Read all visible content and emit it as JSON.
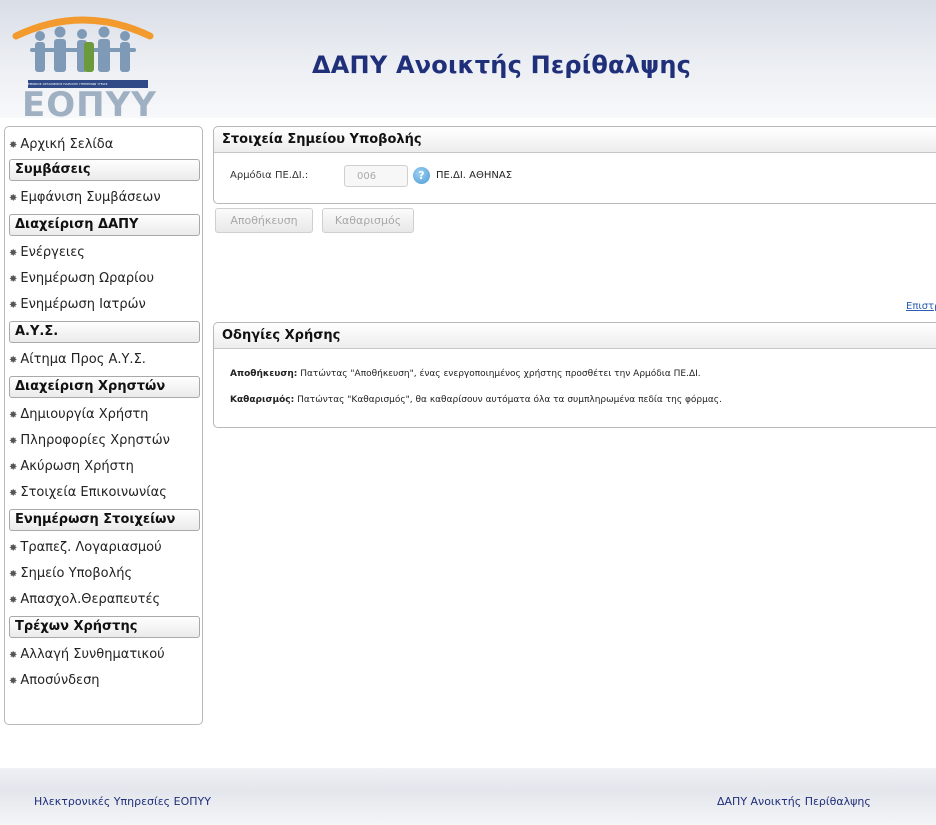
{
  "header": {
    "logo_text": "ΕΟΠΥΥ",
    "logo_subtitle": "ΕΘΝΙΚΟΣ ΟΡΓΑΝΙΣΜΟΣ ΠΑΡΟΧΗΣ ΥΠΗΡΕΣΙΩΝ ΥΓΕΙΑΣ",
    "app_title": "ΔΑΠΥ Ανοικτής Περίθαλψης"
  },
  "sidebar": {
    "home": "Αρχική Σελίδα",
    "sections": [
      {
        "title": "Συμβάσεις",
        "items": [
          "Εμφάνιση Συμβάσεων"
        ]
      },
      {
        "title": "Διαχείριση ΔΑΠΥ",
        "items": [
          "Ενέργειες",
          "Ενημέρωση Ωραρίου",
          "Ενημέρωση Ιατρών"
        ]
      },
      {
        "title": "Α.Υ.Σ.",
        "items": [
          "Αίτημα Προς Α.Υ.Σ."
        ]
      },
      {
        "title": "Διαχείριση Χρηστών",
        "items": [
          "Δημιουργία Χρήστη",
          "Πληροφορίες Χρηστών",
          "Ακύρωση Χρήστη",
          "Στοιχεία Επικοινωνίας"
        ]
      },
      {
        "title": "Ενημέρωση Στοιχείων",
        "items": [
          "Τραπεζ. Λογαριασμού",
          "Σημείο Υποβολής",
          "Απασχολ.Θεραπευτές"
        ]
      },
      {
        "title": "Τρέχων Χρήστης",
        "items": [
          "Αλλαγή Συνθηματικού",
          "Αποσύνδεση"
        ]
      }
    ]
  },
  "submission_panel": {
    "title": "Στοιχεία Σημείου Υποβολής",
    "field_label": "Αρμόδια ΠΕ.ΔΙ.:",
    "field_value": "006",
    "field_name": "ΠΕ.ΔΙ. ΑΘΗΝΑΣ",
    "help_glyph": "?"
  },
  "buttons": {
    "save": "Αποθήκευση",
    "clear": "Καθαρισμός"
  },
  "back_link": "Επιστρο",
  "instructions": {
    "title": "Οδηγίες Χρήσης",
    "save_term": "Αποθήκευση:",
    "save_text": " Πατώντας \"Αποθήκευση\", ένας ενεργοποιημένος χρήστης προσθέτει την Αρμόδια ΠΕ.ΔΙ.",
    "clear_term": "Καθαρισμός:",
    "clear_text": " Πατώντας \"Καθαρισμός\", θα καθαρίσουν αυτόματα όλα τα συμπληρωμένα πεδία της φόρμας."
  },
  "footer": {
    "left": "Ηλεκτρονικές Υπηρεσίες ΕΟΠΥΥ",
    "right": "ΔΑΠΥ Ανοικτής Περίθαλψης"
  },
  "colors": {
    "title_blue": "#1f2f7a",
    "link_blue": "#2a5db0",
    "logo_orange": "#f29a2e",
    "logo_green": "#6a9a3c"
  }
}
